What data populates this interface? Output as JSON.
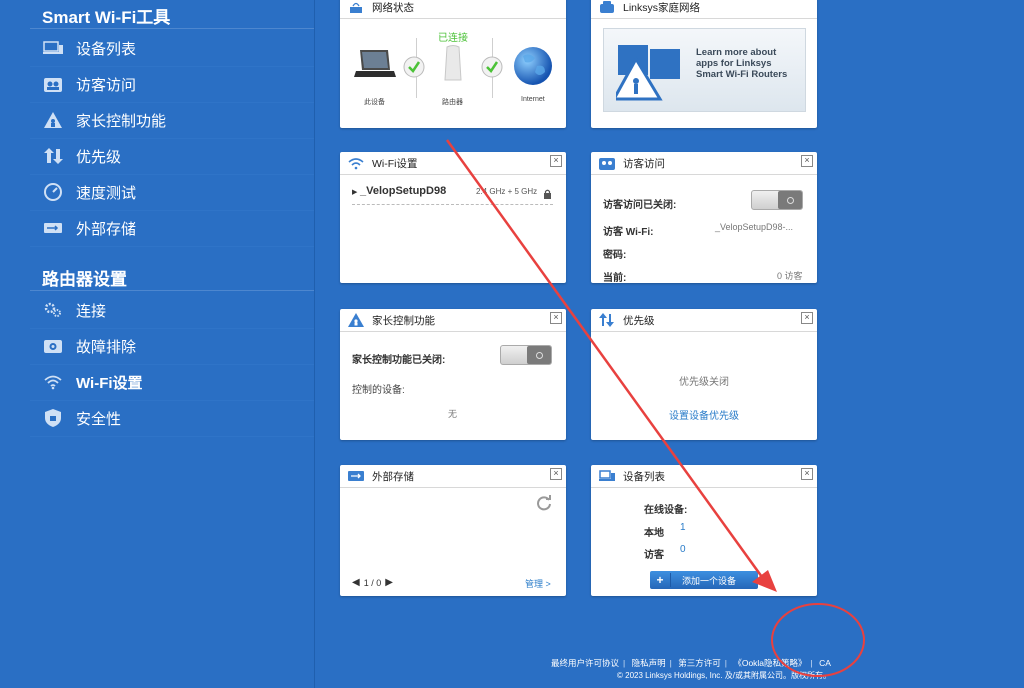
{
  "sidebar": {
    "tools_title": "Smart Wi-Fi工具",
    "tools": [
      {
        "label": "设备列表",
        "icon": "device-list-icon"
      },
      {
        "label": "访客访问",
        "icon": "guest-access-icon"
      },
      {
        "label": "家长控制功能",
        "icon": "parental-control-icon"
      },
      {
        "label": "优先级",
        "icon": "priority-icon"
      },
      {
        "label": "速度测试",
        "icon": "speed-test-icon"
      },
      {
        "label": "外部存储",
        "icon": "external-storage-icon"
      }
    ],
    "router_title": "路由器设置",
    "router": [
      {
        "label": "连接",
        "icon": "connectivity-gear-icon"
      },
      {
        "label": "故障排除",
        "icon": "troubleshoot-icon"
      },
      {
        "label": "Wi-Fi设置",
        "icon": "wifi-icon"
      },
      {
        "label": "安全性",
        "icon": "security-shield-icon"
      }
    ]
  },
  "network_status": {
    "title": "网络状态",
    "connected": "已连接",
    "this_device": "此设备",
    "router": "路由器",
    "internet": "Internet"
  },
  "home_network": {
    "title": "Linksys家庭网络",
    "promo": "Learn more about apps for Linksys Smart Wi-Fi Routers"
  },
  "wifi_settings": {
    "title": "Wi-Fi设置",
    "ssid": "_VelopSetupD98",
    "band": "2.4 GHz + 5 GHz"
  },
  "guest_access": {
    "title": "访客访问",
    "status_label": "访客访问已关闭:",
    "wifi_label": "访客 Wi-Fi:",
    "wifi_value": "_VelopSetupD98-...",
    "password_label": "密码:",
    "current_label": "当前:",
    "current_value": "0 访客"
  },
  "parental": {
    "title": "家长控制功能",
    "status_label": "家长控制功能已关闭:",
    "devices_label": "控制的设备:",
    "devices_value": "无"
  },
  "priority": {
    "title": "优先级",
    "status": "优先级关闭",
    "setup_link": "设置设备优先级"
  },
  "storage": {
    "title": "外部存储",
    "pager": "1 / 0",
    "manage_link": "管理 >"
  },
  "device_list": {
    "title": "设备列表",
    "online_label": "在线设备:",
    "local_label": "本地",
    "local_value": "1",
    "guest_label": "访客",
    "guest_value": "0",
    "add_button": "添加一个设备"
  },
  "footer": {
    "links": [
      "最终用户许可协议",
      "隐私声明",
      "第三方许可",
      "《Ookla隐私策略》",
      "CA"
    ],
    "copyright": "© 2023 Linksys Holdings, Inc. 及/或其附属公司。版权所有。"
  },
  "colors": {
    "background": "#2a6fc4",
    "link": "#2a7cc9",
    "connected": "#4cc238",
    "annotation": "#e8413f"
  }
}
